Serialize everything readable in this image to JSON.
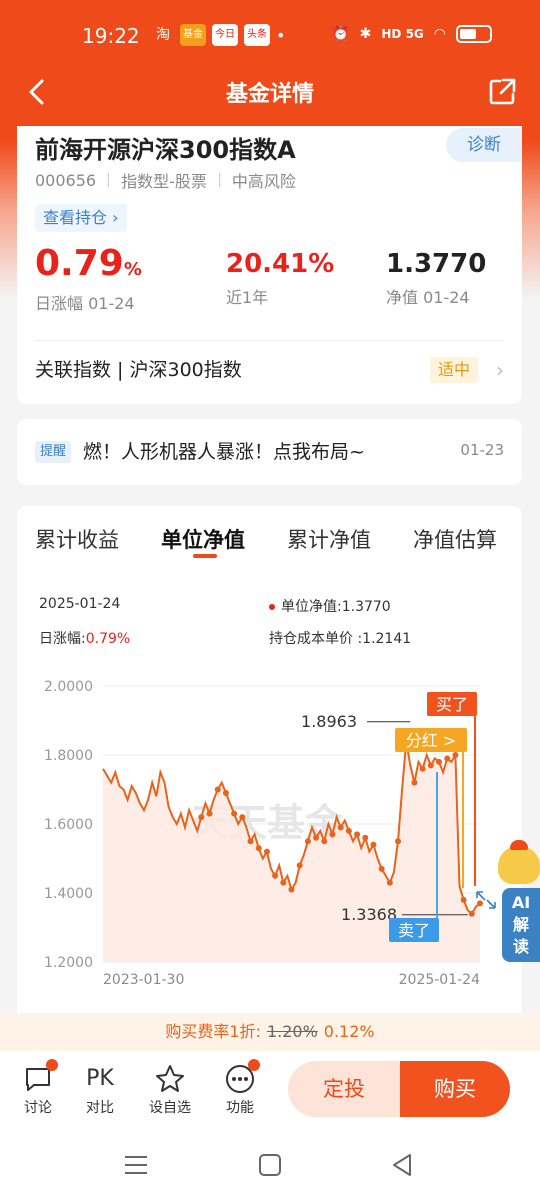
{
  "status": {
    "time": "19:22",
    "apps": [
      {
        "label": "淘",
        "color": "#ee4a1a"
      },
      {
        "label": "基金",
        "color": "#f2a019"
      },
      {
        "label": "今日",
        "color": "#e8231b"
      },
      {
        "label": "头条",
        "color": "#e8231b"
      }
    ],
    "indicators": "HD 5G"
  },
  "nav": {
    "title": "基金详情"
  },
  "fund": {
    "name": "前海开源沪深300指数A",
    "diagnose": "诊断",
    "code": "000656",
    "type": "指数型-股票",
    "risk": "中高风险",
    "holdings_link": "查看持仓 ›",
    "daily_change": "0.79",
    "daily_change_unit": "%",
    "daily_change_label": "日涨幅 01-24",
    "year_return": "20.41%",
    "year_return_label": "近1年",
    "nav": "1.3770",
    "nav_label": "净值 01-24",
    "index_row": "关联指数 | 沪深300指数",
    "index_badge": "适中"
  },
  "reminder": {
    "tag": "提醒",
    "text": "燃！人形机器人暴涨！点我布局~",
    "date": "01-23"
  },
  "tabs": [
    {
      "label": "累计收益"
    },
    {
      "label": "单位净值"
    },
    {
      "label": "累计净值"
    },
    {
      "label": "净值估算"
    }
  ],
  "chart_info": {
    "date": "2025-01-24",
    "nav_label": "单位净值:1.3770",
    "daily_label": "日涨幅:",
    "daily_value": "0.79%",
    "cost_label": "持仓成本单价 :1.2141"
  },
  "chart_data": {
    "type": "line",
    "watermark": "天天基金",
    "ylim": [
      1.2,
      2.0
    ],
    "y_ticks": [
      "2.0000",
      "1.8000",
      "1.6000",
      "1.4000",
      "1.2000"
    ],
    "x_start_label": "2023-01-30",
    "x_end_label": "2025-01-24",
    "values": [
      1.76,
      1.74,
      1.72,
      1.75,
      1.71,
      1.7,
      1.67,
      1.71,
      1.69,
      1.66,
      1.64,
      1.67,
      1.72,
      1.68,
      1.75,
      1.72,
      1.65,
      1.62,
      1.6,
      1.63,
      1.59,
      1.64,
      1.61,
      1.58,
      1.62,
      1.66,
      1.63,
      1.67,
      1.7,
      1.72,
      1.69,
      1.66,
      1.63,
      1.6,
      1.62,
      1.59,
      1.55,
      1.57,
      1.53,
      1.5,
      1.52,
      1.47,
      1.45,
      1.48,
      1.43,
      1.45,
      1.41,
      1.43,
      1.48,
      1.51,
      1.55,
      1.59,
      1.56,
      1.58,
      1.55,
      1.6,
      1.57,
      1.62,
      1.59,
      1.61,
      1.58,
      1.55,
      1.57,
      1.53,
      1.56,
      1.52,
      1.54,
      1.5,
      1.47,
      1.45,
      1.43,
      1.46,
      1.55,
      1.7,
      1.84,
      1.77,
      1.72,
      1.78,
      1.76,
      1.8,
      1.77,
      1.79,
      1.78,
      1.75,
      1.79,
      1.78,
      1.8,
      1.42,
      1.38,
      1.35,
      1.34,
      1.36,
      1.37
    ],
    "annotations": {
      "high_value": "1.8963",
      "low_value": "1.3368",
      "buy": "买了",
      "sell": "卖了",
      "dividend": "分红 >"
    }
  },
  "promo": {
    "prefix": "购买费率1折:",
    "old_rate": "1.20%",
    "new_rate": "0.12%"
  },
  "toolbar": {
    "items": [
      {
        "label": "讨论"
      },
      {
        "label": "对比",
        "icon_text": "PK"
      },
      {
        "label": "设自选"
      },
      {
        "label": "功能"
      }
    ],
    "dingtou": "定投",
    "buy": "购买"
  },
  "ai_widget": {
    "label": "AI解读",
    "line1": "AI",
    "line2": "解",
    "line3": "读"
  }
}
